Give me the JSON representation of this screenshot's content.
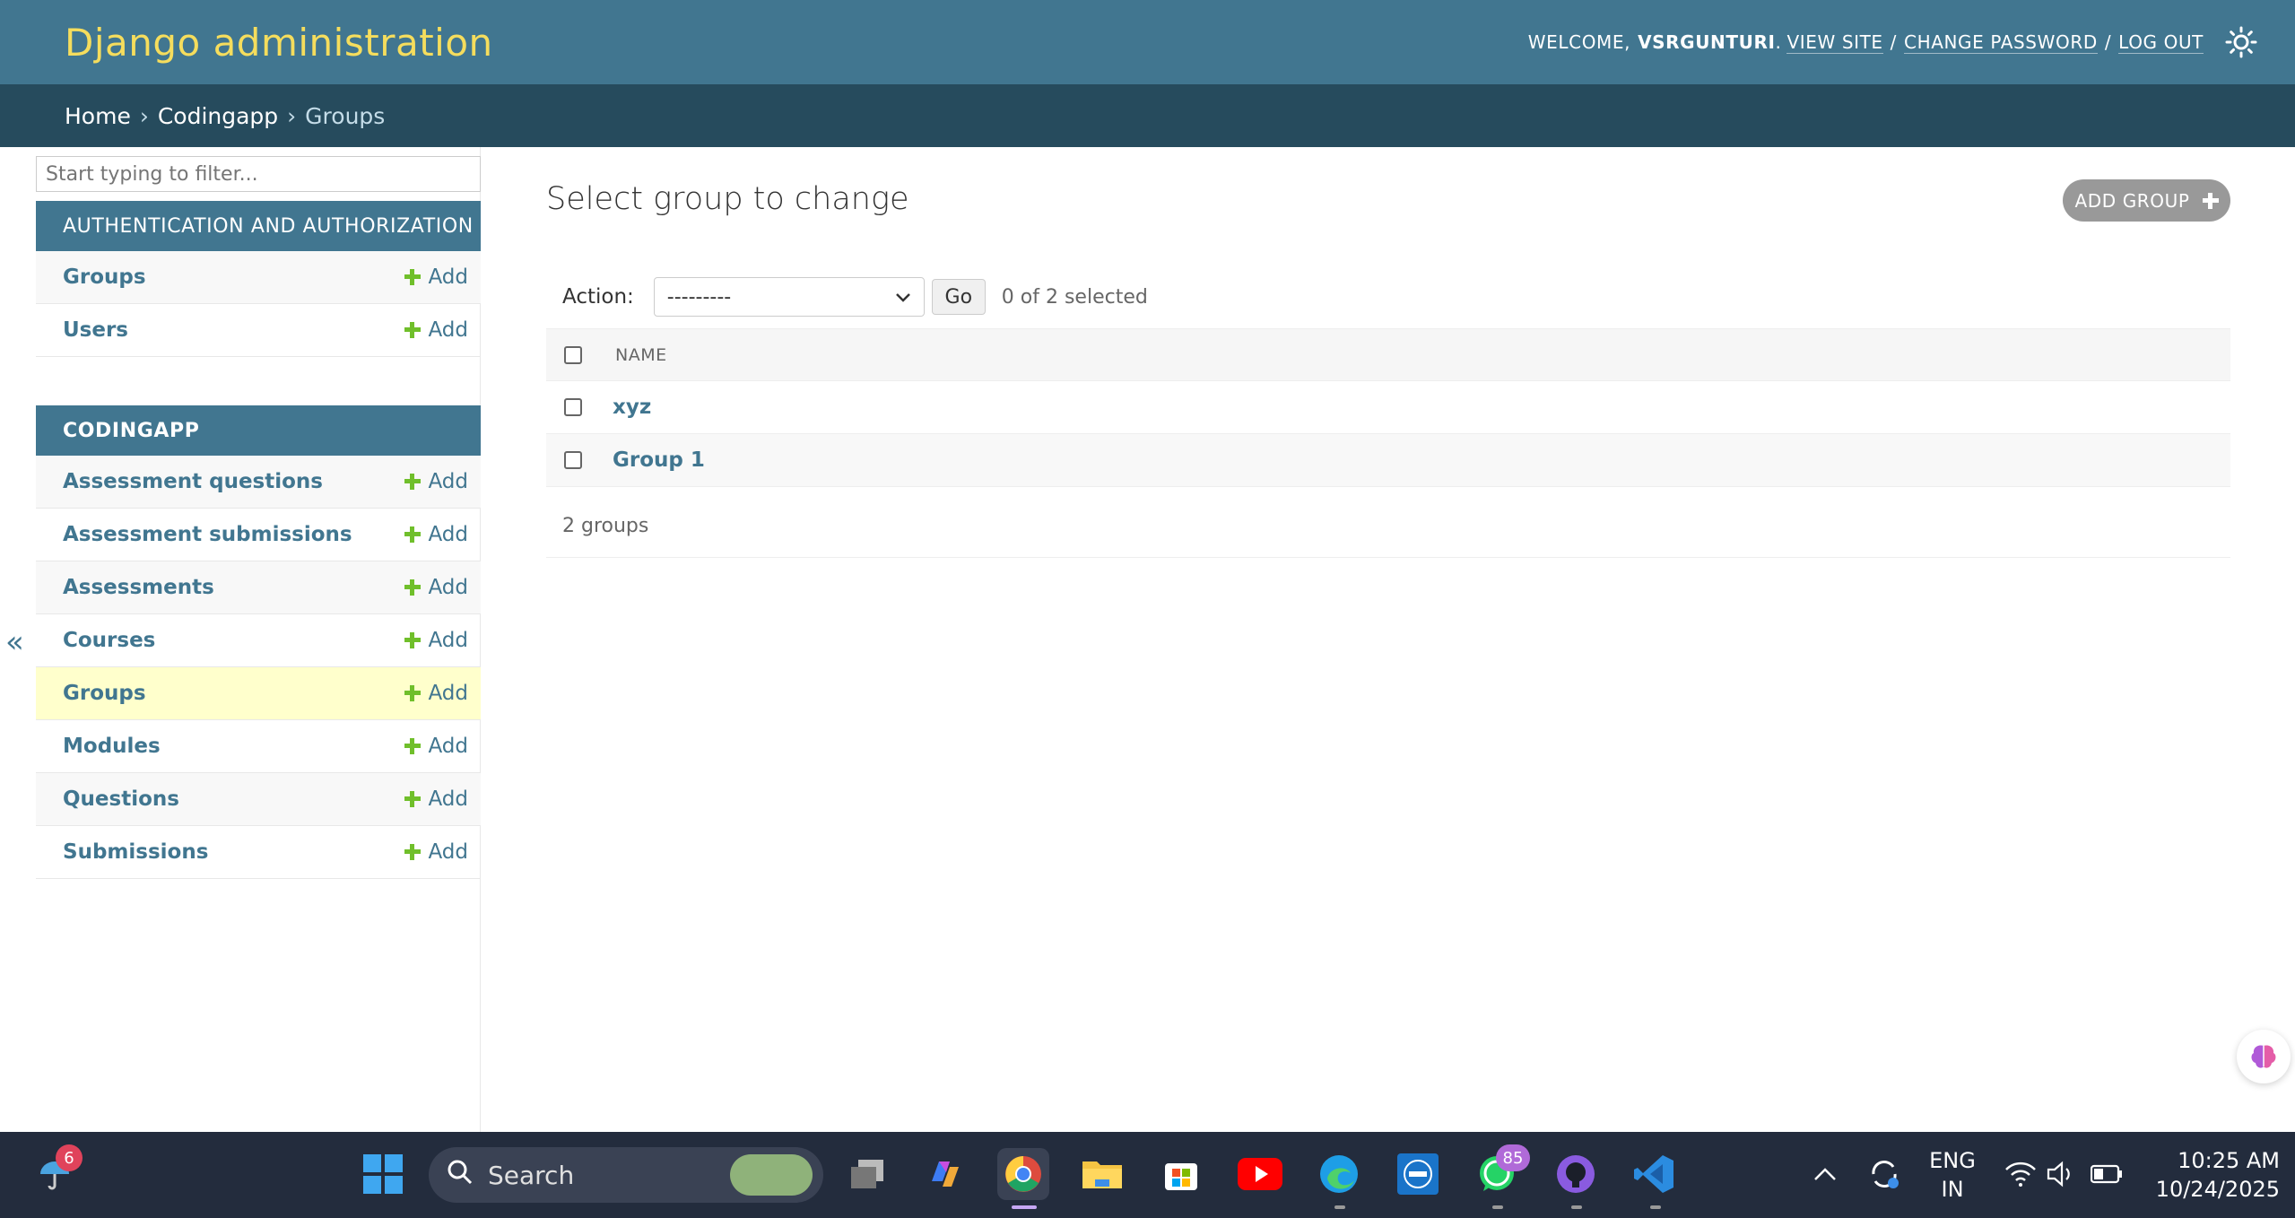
{
  "header": {
    "site_title": "Django administration",
    "welcome": "WELCOME,",
    "username": "VSRGUNTURI",
    "view_site": "VIEW SITE",
    "change_password": "CHANGE PASSWORD",
    "log_out": "LOG OUT",
    "separator": "/",
    "theme_icon": "sun-icon"
  },
  "breadcrumbs": {
    "home": "Home",
    "app": "Codingapp",
    "current": "Groups",
    "separator": "›"
  },
  "sidebar": {
    "filter_placeholder": "Start typing to filter...",
    "collapse_glyph": "«",
    "modules": [
      {
        "caption": "AUTHENTICATION AND AUTHORIZATION",
        "models": [
          {
            "name": "Groups",
            "add": "Add"
          },
          {
            "name": "Users",
            "add": "Add"
          }
        ]
      },
      {
        "caption": "CODINGAPP",
        "models": [
          {
            "name": "Assessment questions",
            "add": "Add"
          },
          {
            "name": "Assessment submissions",
            "add": "Add"
          },
          {
            "name": "Assessments",
            "add": "Add"
          },
          {
            "name": "Courses",
            "add": "Add"
          },
          {
            "name": "Groups",
            "add": "Add",
            "current": true
          },
          {
            "name": "Modules",
            "add": "Add"
          },
          {
            "name": "Questions",
            "add": "Add"
          },
          {
            "name": "Submissions",
            "add": "Add"
          }
        ]
      }
    ]
  },
  "main": {
    "title": "Select group to change",
    "add_button": "ADD GROUP",
    "actions": {
      "label": "Action:",
      "selected_value": "---------",
      "go": "Go",
      "selection_count": "0 of 2 selected"
    },
    "table": {
      "column_name": "NAME",
      "rows": [
        {
          "name": "xyz"
        },
        {
          "name": "Group 1"
        }
      ]
    },
    "paginator": "2 groups"
  },
  "taskbar": {
    "weather_badge": "6",
    "search_placeholder": "Search",
    "whatsapp_badge": "85",
    "language_line1": "ENG",
    "language_line2": "IN",
    "time": "10:25 AM",
    "date": "10/24/2025"
  },
  "colors": {
    "header": "#417690",
    "breadcrumb": "#264b5d",
    "brand_yellow": "#f5dd5d",
    "link": "#417690",
    "add_green": "#70bf2b",
    "current_row": "#ffffcc",
    "taskbar": "#232c3d"
  }
}
